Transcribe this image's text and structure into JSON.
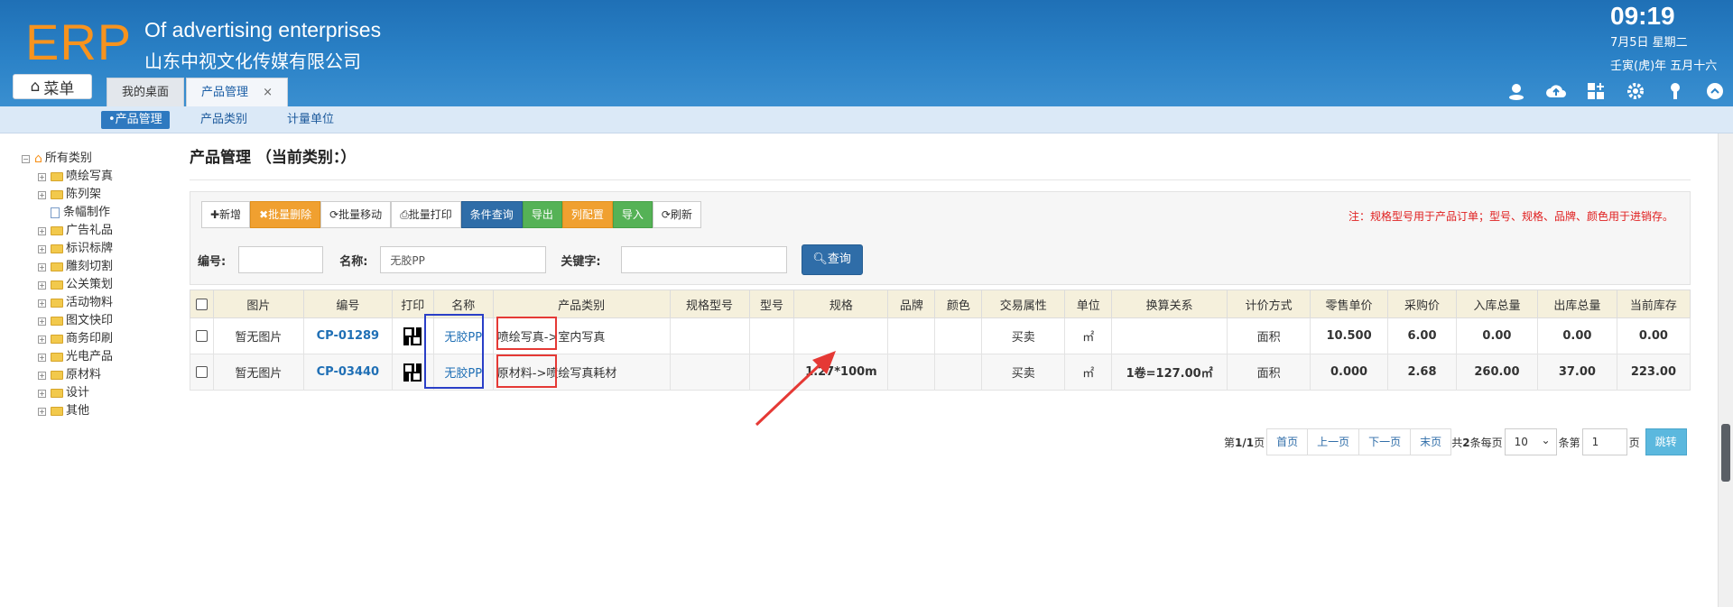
{
  "header": {
    "logo": "ERP",
    "tagline": "Of advertising enterprises",
    "company": "山东中视文化传媒有限公司",
    "time": "09:19",
    "date": "7月5日 星期二",
    "lunar": "壬寅(虎)年 五月十六",
    "menu_label": "菜单",
    "tabs": [
      {
        "label": "我的桌面"
      },
      {
        "label": "产品管理",
        "close": "×"
      }
    ],
    "icons": [
      "user-icon",
      "cloud-icon",
      "grid-icon",
      "settings-icon",
      "key-icon",
      "collapse-icon"
    ]
  },
  "subnav": {
    "items": [
      {
        "label": "•产品管理"
      },
      {
        "label": "产品类别"
      },
      {
        "label": "计量单位"
      }
    ]
  },
  "tree": {
    "root": "所有类别",
    "items": [
      {
        "label": "喷绘写真",
        "type": "folder"
      },
      {
        "label": "陈列架",
        "type": "folder"
      },
      {
        "label": "条幅制作",
        "type": "doc"
      },
      {
        "label": "广告礼品",
        "type": "folder"
      },
      {
        "label": "标识标牌",
        "type": "folder"
      },
      {
        "label": "雕刻切割",
        "type": "folder"
      },
      {
        "label": "公关策划",
        "type": "folder"
      },
      {
        "label": "活动物料",
        "type": "folder"
      },
      {
        "label": "图文快印",
        "type": "folder"
      },
      {
        "label": "商务印刷",
        "type": "folder"
      },
      {
        "label": "光电产品",
        "type": "folder"
      },
      {
        "label": "原材料",
        "type": "folder"
      },
      {
        "label": "设计",
        "type": "folder"
      },
      {
        "label": "其他",
        "type": "folder"
      }
    ]
  },
  "main": {
    "title": "产品管理 （当前类别：）",
    "buttons": [
      {
        "label": "✚新增",
        "style": "default"
      },
      {
        "label": "✖批量删除",
        "style": "orange"
      },
      {
        "label": "⟳批量移动",
        "style": "default"
      },
      {
        "label": "⎙批量打印",
        "style": "default"
      },
      {
        "label": "条件查询",
        "style": "blue"
      },
      {
        "label": "导出",
        "style": "green"
      },
      {
        "label": "列配置",
        "style": "orange"
      },
      {
        "label": "导入",
        "style": "green"
      },
      {
        "label": "⟳刷新",
        "style": "default"
      }
    ],
    "note": "注：规格型号用于产品订单；型号、规格、品牌、颜色用于进销存。",
    "search": {
      "code_label": "编号:",
      "code_value": "",
      "name_label": "名称:",
      "name_value": "无胶PP",
      "keyword_label": "关键字:",
      "keyword_value": "",
      "query_label": "查询"
    }
  },
  "table": {
    "headers": [
      "",
      "图片",
      "编号",
      "打印",
      "名称",
      "产品类别",
      "规格型号",
      "型号",
      "规格",
      "品牌",
      "颜色",
      "交易属性",
      "单位",
      "换算关系",
      "计价方式",
      "零售单价",
      "采购价",
      "入库总量",
      "出库总量",
      "当前库存"
    ],
    "rows": [
      {
        "image": "暂无图片",
        "code": "CP-01289",
        "name": "无胶PP",
        "category": "喷绘写真->室内写真",
        "spec_model": "",
        "model": "",
        "spec": "",
        "brand": "",
        "color": "",
        "trade": "买卖",
        "unit": "㎡",
        "conversion": "",
        "pricing": "面积",
        "retail": "10.500",
        "purchase": "6.00",
        "in_total": "0.00",
        "out_total": "0.00",
        "stock": "0.00"
      },
      {
        "image": "暂无图片",
        "code": "CP-03440",
        "name": "无胶PP",
        "category": "原材料->喷绘写真耗材",
        "spec_model": "",
        "model": "",
        "spec": "1.27*100m",
        "brand": "",
        "color": "",
        "trade": "买卖",
        "unit": "㎡",
        "conversion": "1卷=127.00㎡",
        "pricing": "面积",
        "retail": "0.000",
        "purchase": "2.68",
        "in_total": "260.00",
        "out_total": "37.00",
        "stock": "223.00"
      }
    ]
  },
  "pager": {
    "page_info_prefix": "第",
    "page_info_bold": "1/1",
    "page_info_suffix": "页",
    "first": "首页",
    "prev": "上一页",
    "next": "下一页",
    "last": "末页",
    "total_prefix": "共",
    "total_bold": "2",
    "total_suffix": "条每页",
    "per_page": "10",
    "goto_prefix": "条第",
    "goto_value": "1",
    "goto_suffix": "页",
    "jump": "跳转"
  },
  "colors": {
    "header_blue": "#2b82c7",
    "logo_orange": "#f7931e",
    "note_red": "#e02020",
    "link_blue": "#1f6fb5"
  }
}
